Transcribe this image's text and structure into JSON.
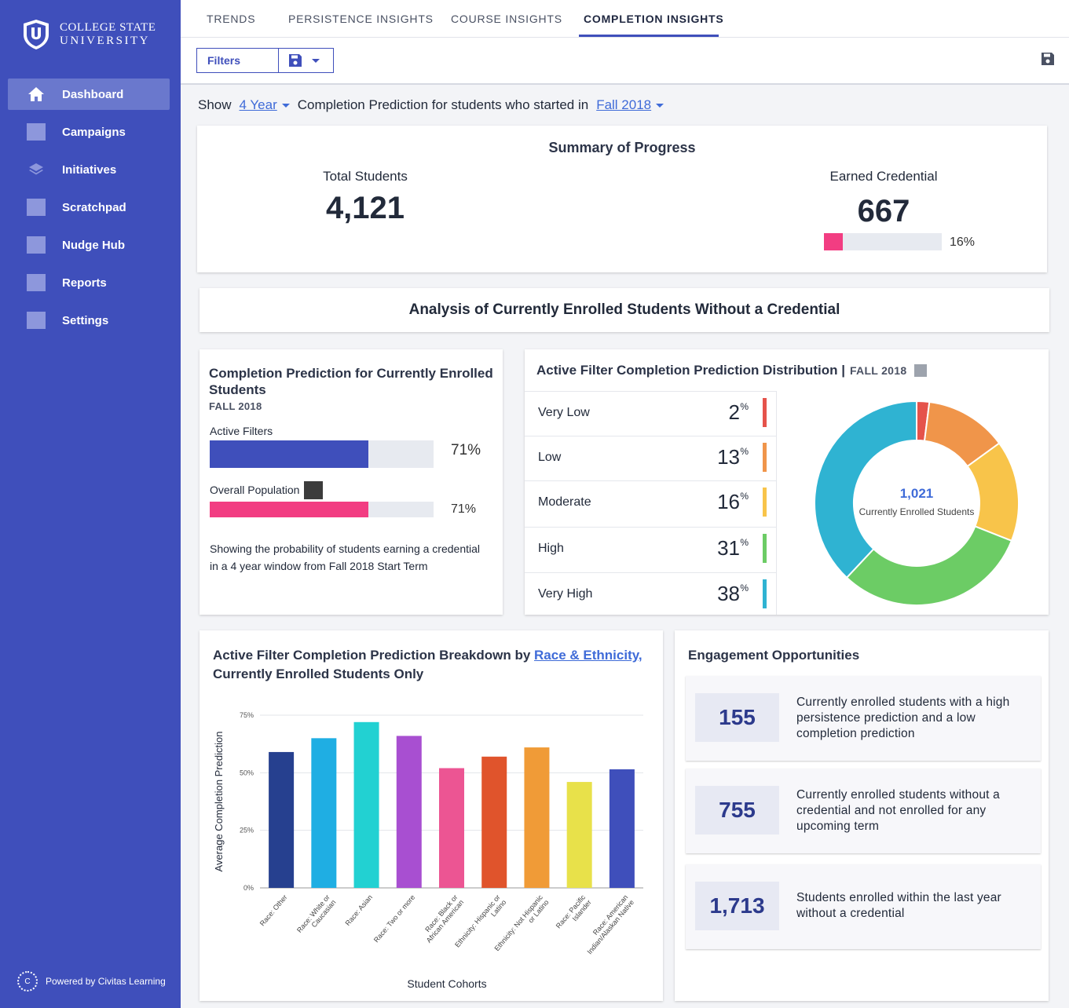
{
  "brand": {
    "line1": "COLLEGE STATE",
    "line2": "UNIVERSITY"
  },
  "sidebar": {
    "items": [
      {
        "label": "Dashboard",
        "icon": "home-icon"
      },
      {
        "label": "Campaigns",
        "icon": "square-icon"
      },
      {
        "label": "Initiatives",
        "icon": "layers-icon"
      },
      {
        "label": "Scratchpad",
        "icon": "square-icon"
      },
      {
        "label": "Nudge Hub",
        "icon": "square-icon"
      },
      {
        "label": "Reports",
        "icon": "square-icon"
      },
      {
        "label": "Settings",
        "icon": "square-icon"
      }
    ],
    "powered": "Powered by Civitas Learning",
    "powered_logo": "C"
  },
  "tabs": [
    "TRENDS",
    "PERSISTENCE INSIGHTS",
    "COURSE INSIGHTS",
    "COMPLETION INSIGHTS"
  ],
  "toolbar": {
    "filters_label": "Filters"
  },
  "show_line": {
    "show": "Show",
    "window": "4 Year",
    "text": "Completion Prediction for students who started in",
    "term": "Fall 2018"
  },
  "summary": {
    "title": "Summary of Progress",
    "total_label": "Total Students",
    "total_value": "4,121",
    "earned_label": "Earned Credential",
    "earned_value": "667",
    "earned_pct": "16%",
    "earned_fraction": 0.16
  },
  "analysis_title": "Analysis of Currently Enrolled Students Without a Credential",
  "completion_card": {
    "title": "Completion Prediction for Currently Enrolled Students",
    "term": "FALL 2018",
    "active_label": "Active Filters",
    "active_pct": "71%",
    "active_fraction": 0.71,
    "overall_label": "Overall Population",
    "overall_pct": "71%",
    "overall_fraction": 0.71,
    "note": "Showing the probability of students earning a credential in a 4 year window from Fall 2018 Start Term"
  },
  "distribution": {
    "title": "Active Filter Completion Prediction Distribution |",
    "term": "FALL 2018",
    "rows": [
      {
        "label": "Very Low",
        "value": "2",
        "color": "#e5534b"
      },
      {
        "label": "Low",
        "value": "13",
        "color": "#f0954a"
      },
      {
        "label": "Moderate",
        "value": "16",
        "color": "#f8c44a"
      },
      {
        "label": "High",
        "value": "31",
        "color": "#6ccc65"
      },
      {
        "label": "Very High",
        "value": "38",
        "color": "#2fb3d2"
      }
    ],
    "pct_symbol": "%",
    "center_value": "1,021",
    "center_label": "Currently Enrolled Students"
  },
  "breakdown": {
    "title_prefix": "Active Filter Completion Prediction Breakdown by",
    "title_link": "Race & Ethnicity,",
    "title_suffix": "Currently Enrolled Students Only"
  },
  "chart_data": {
    "type": "bar",
    "categories": [
      "Race: Other",
      "Race: White or Caucasian",
      "Race: Asian",
      "Race: Two or more",
      "Race: Black or African American",
      "Ethnicity: Hispanic or Latino",
      "Ethnicity: Not Hispanic or Latino",
      "Race: Pacific Islander",
      "Race: American Indian/Alaskan Native"
    ],
    "category_lines": [
      [
        "Race: Other"
      ],
      [
        "Race: White or",
        "Caucasian"
      ],
      [
        "Race: Asian"
      ],
      [
        "Race: Two or more"
      ],
      [
        "Race: Black or",
        "African American"
      ],
      [
        "Ethnicity: Hispanic or",
        "Latino"
      ],
      [
        "Ethnicity: Not Hispanic",
        "or Latino"
      ],
      [
        "Race: Pacific",
        "Islander"
      ],
      [
        "Race: American",
        "Indian/Alaskan Native"
      ]
    ],
    "values": [
      59,
      65,
      72,
      66,
      52,
      57,
      61,
      46,
      51.5
    ],
    "colors": [
      "#26408f",
      "#1faee3",
      "#22d1d2",
      "#a84fd1",
      "#ec5593",
      "#e0542c",
      "#f09b37",
      "#e8e14a",
      "#3f4fbb"
    ],
    "ylim": [
      0,
      75
    ],
    "yticks": [
      "0%",
      "25%",
      "50%",
      "75%"
    ],
    "ylabel": "Average Completion Prediction",
    "xlabel": "Student Cohorts",
    "grid": true
  },
  "engagement": {
    "title": "Engagement Opportunities",
    "items": [
      {
        "value": "155",
        "text": "Currently enrolled students with a high persistence prediction and a low completion prediction"
      },
      {
        "value": "755",
        "text": "Currently enrolled students without a credential and not enrolled for any upcoming term"
      },
      {
        "value": "1,713",
        "text": "Students enrolled within the last year without a credential"
      }
    ]
  }
}
